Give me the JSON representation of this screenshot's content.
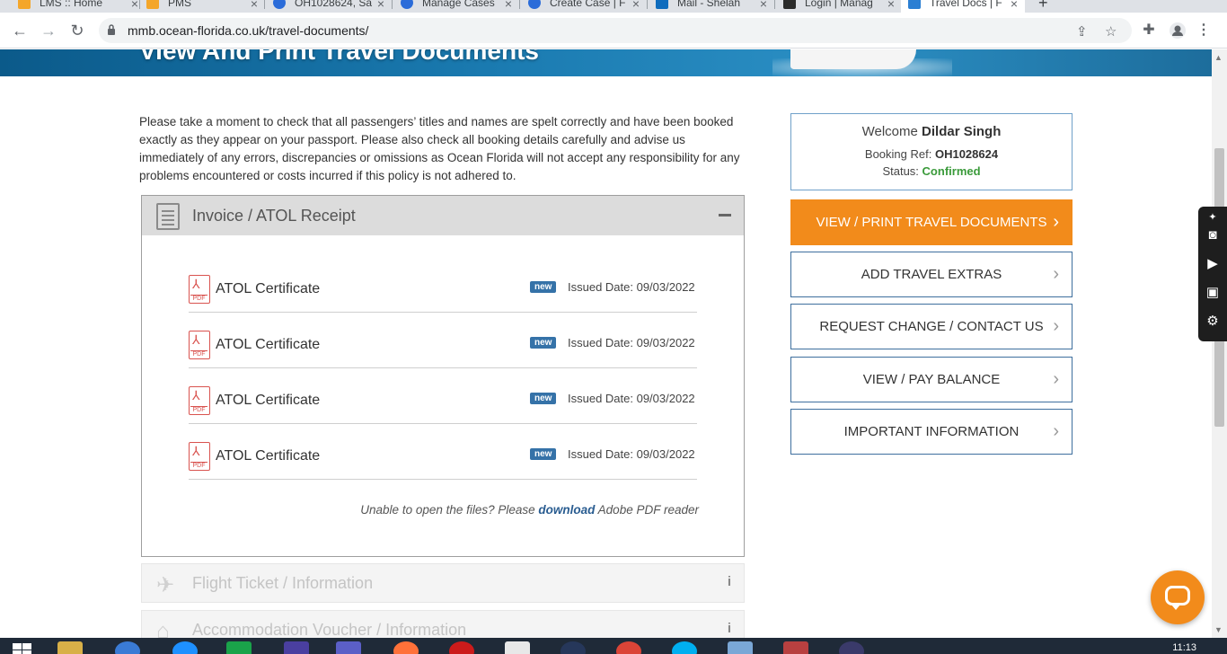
{
  "browser": {
    "tabs": [
      {
        "title": "LMS :: Home",
        "color": "#f4a62a"
      },
      {
        "title": "PMS",
        "color": "#f4a62a"
      },
      {
        "title": "OH1028624, Sa",
        "color": "#2b6cd9"
      },
      {
        "title": "Manage Cases",
        "color": "#2b6cd9"
      },
      {
        "title": "Create Case | F",
        "color": "#2b6cd9"
      },
      {
        "title": "Mail - Shelah",
        "color": "#0f6cbd"
      },
      {
        "title": "Login | Manag",
        "color": "#2b2b2b"
      },
      {
        "title": "Travel Docs | F",
        "color": "#2b7fd3"
      }
    ],
    "new_tab": "+",
    "url": "mmb.ocean-florida.co.uk/travel-documents/"
  },
  "banner": {
    "title": "View And Print Travel Documents"
  },
  "intro": "Please take a moment to check that all passengers’ titles and names are spelt correctly and have been booked exactly as they appear on your passport. Please also check all booking details carefully and advise us immediately of any errors, discrepancies or omissions as Ocean Florida will not accept any responsibility for any problems encountered or costs incurred if this policy is not adhered to.",
  "invoice_section": {
    "title": "Invoice / ATOL Receipt",
    "documents": [
      {
        "name": "ATOL Certificate",
        "badge": "new",
        "issued": "Issued Date: 09/03/2022",
        "icon_label": "PDF"
      },
      {
        "name": "ATOL Certificate",
        "badge": "new",
        "issued": "Issued Date: 09/03/2022",
        "icon_label": "PDF"
      },
      {
        "name": "ATOL Certificate",
        "badge": "new",
        "issued": "Issued Date: 09/03/2022",
        "icon_label": "PDF"
      },
      {
        "name": "ATOL Certificate",
        "badge": "new",
        "issued": "Issued Date: 09/03/2022",
        "icon_label": "PDF"
      }
    ],
    "help_prefix": "Unable to open the files? Please ",
    "help_link": "download",
    "help_suffix": " Adobe PDF reader"
  },
  "other_sections": [
    {
      "title": "Flight Ticket / Information",
      "icon": "plane-icon",
      "info": "i"
    },
    {
      "title": "Accommodation Voucher / Information",
      "icon": "hotel-icon",
      "info": "i"
    }
  ],
  "welcome": {
    "greeting": "Welcome",
    "name": "Dildar Singh",
    "booking_label": "Booking Ref:",
    "booking_ref": "OH1028624",
    "status_label": "Status:",
    "status": "Confirmed"
  },
  "sidebar_buttons": [
    "VIEW / PRINT TRAVEL DOCUMENTS",
    "ADD TRAVEL EXTRAS",
    "REQUEST CHANGE / CONTACT US",
    "VIEW / PAY BALANCE",
    "IMPORTANT INFORMATION"
  ],
  "colors": {
    "accent_orange": "#f28b1b",
    "border_blue": "#3e6f9e",
    "status_green": "#3a9a3a"
  },
  "taskbar": {
    "clock": "11:13"
  }
}
